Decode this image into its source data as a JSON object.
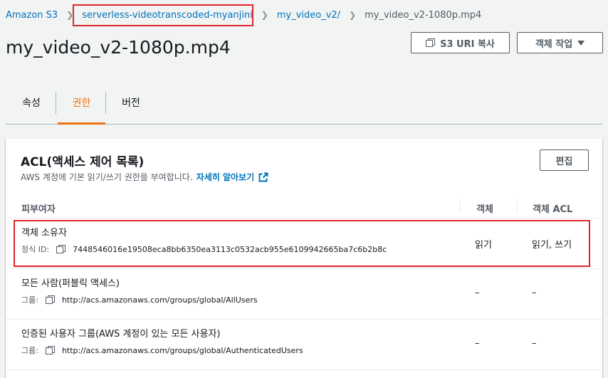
{
  "breadcrumb": {
    "items": [
      {
        "label": "Amazon S3"
      },
      {
        "label": "serverless-videotranscoded-myanjini"
      },
      {
        "label": "my_video_v2/"
      },
      {
        "label": "my_video_v2-1080p.mp4"
      }
    ]
  },
  "page": {
    "title": "my_video_v2-1080p.mp4"
  },
  "actions": {
    "copy_uri_label": "S3 URI 복사",
    "object_actions_label": "객체 작업"
  },
  "tabs": [
    {
      "label": "속성"
    },
    {
      "label": "권한"
    },
    {
      "label": "버전"
    }
  ],
  "acl": {
    "title": "ACL(액세스 제어 목록)",
    "description": "AWS 계정에 기본 읽기/쓰기 권한을 부여합니다.",
    "learn_more": "자세히 알아보기",
    "edit_label": "편집",
    "columns": {
      "grantee": "피부여자",
      "object": "객체",
      "object_acl": "객체 ACL"
    },
    "rows": [
      {
        "name": "객체 소유자",
        "id_label": "정식 ID:",
        "id_value": "7448546016e19508eca8bb6350ea3113c0532acb955e6109942665ba7c6b2b8c",
        "object": "읽기",
        "object_acl": "읽기, 쓰기"
      },
      {
        "name": "모든 사람(퍼블릭 액세스)",
        "id_label": "그룹:",
        "id_value": "http://acs.amazonaws.com/groups/global/AllUsers",
        "object": "–",
        "object_acl": "–"
      },
      {
        "name": "인증된 사용자 그룹(AWS 계정이 있는 모든 사용자)",
        "id_label": "그룹:",
        "id_value": "http://acs.amazonaws.com/groups/global/AuthenticatedUsers",
        "object": "–",
        "object_acl": "–"
      }
    ]
  },
  "colors": {
    "link": "#0073bb",
    "active_tab": "#ec7211",
    "highlight": "#e0252b",
    "background": "#f2f3f3"
  }
}
